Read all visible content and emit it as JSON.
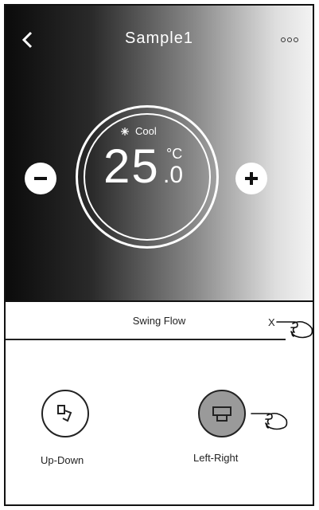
{
  "header": {
    "title": "Sample1"
  },
  "thermostat": {
    "mode": "Cool",
    "temperature": "25",
    "unit": "°C",
    "decimal": ".0"
  },
  "sheet": {
    "title": "Swing Flow",
    "close_label": "X"
  },
  "options": [
    {
      "label": "Up-Down",
      "selected": false,
      "icon": "updown-swing-icon"
    },
    {
      "label": "Left-Right",
      "selected": true,
      "icon": "leftright-swing-icon"
    }
  ],
  "colors": {
    "selected_bg": "#9a9a9a",
    "text": "#222222"
  }
}
